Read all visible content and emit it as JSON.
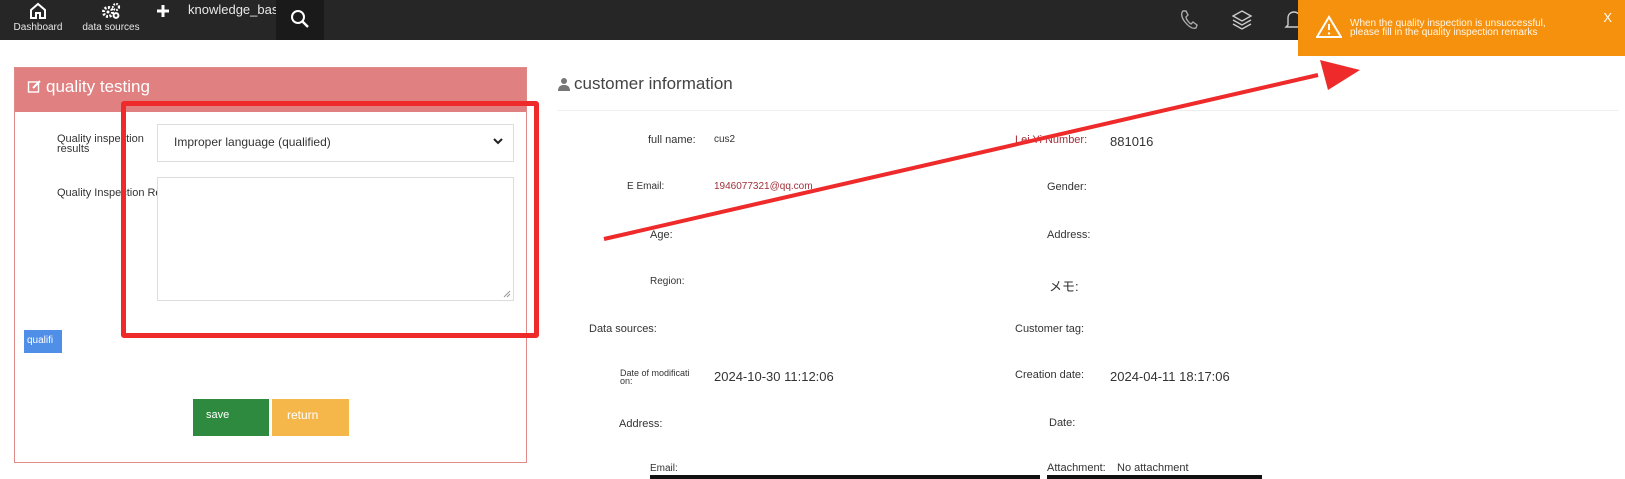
{
  "nav": {
    "dashboard_label": "Dashboard",
    "data_sources_label": "data sources",
    "knowledge_base_label": "knowledge_base"
  },
  "toast": {
    "message_line1": "When the quality inspection is unsuccessful,",
    "message_line2": "please fill in the quality inspection remarks",
    "close_label": "X",
    "color": "#f6910d"
  },
  "quality": {
    "title": "quality testing",
    "results_label_line1": "Quality inspection",
    "results_label_line2": "results",
    "results_value": "Improper language (qualified)",
    "remarks_label": "Quality Inspection Remarks",
    "chip_text": "qualifi",
    "save_label": "save",
    "return_label": "return"
  },
  "customer": {
    "title": "customer information",
    "full_name_label": "full name:",
    "full_name_value": "cus2",
    "lei_yi_label": "Lei Yi Number:",
    "lei_yi_value": "881016",
    "email_label": "E Email:",
    "email_value": "1946077321@qq.com",
    "gender_label": "Gender:",
    "age_label": "Age:",
    "address_label": "Address:",
    "region_label": "Region:",
    "memo_label": "メモ:",
    "data_sources_label": "Data sources:",
    "customer_tag_label": "Customer tag:",
    "modification_label_line1": "Date of modificati",
    "modification_label_line2": "on:",
    "modification_value": "2024-10-30 11:12:06",
    "creation_label": "Creation date:",
    "creation_value": "2024-04-11 18:17:06",
    "address2_label": "Address:",
    "date_label": "Date:",
    "email2_label": "Email:",
    "attachment_label": "Attachment:",
    "attachment_value": "No attachment"
  }
}
